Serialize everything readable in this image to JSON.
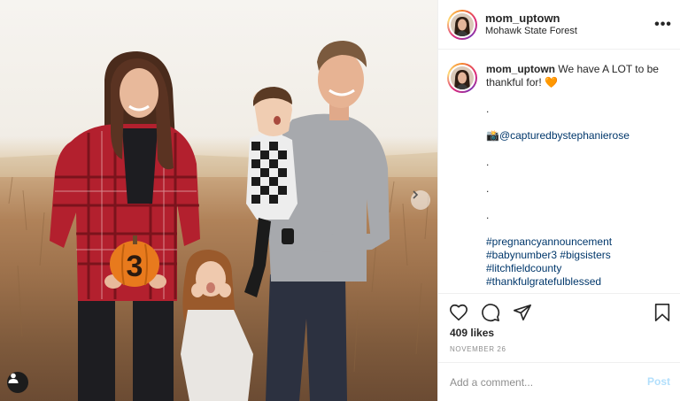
{
  "post": {
    "username": "mom_uptown",
    "location": "Mohawk State Forest",
    "more_label": "•••",
    "caption": {
      "username": "mom_uptown",
      "text": " We have A LOT to be thankful for! ",
      "heart_emoji": "🧡",
      "dot1": ".",
      "camera_emoji": "📸",
      "credit": "@capturedbystephanierose",
      "dot2": ".",
      "dot3": ".",
      "dot4": ".",
      "hashtags": [
        "#pregnancyannouncement",
        "#babynumber3 #bigsisters",
        "#litchfieldcounty",
        "#thankfulgratefulblessed"
      ]
    },
    "likes": "409 likes",
    "date": "NOVEMBER 26",
    "comment_placeholder": "Add a comment...",
    "post_label": "Post",
    "pumpkin_number": "3"
  },
  "colors": {
    "accent": "#0095f6",
    "post_disabled": "#b2dffc",
    "link": "#00376b",
    "muted": "#8e8e8e",
    "border": "#efefef"
  },
  "icons": {
    "more": "more-options-icon",
    "like": "heart-icon",
    "comment": "comment-icon",
    "share": "paper-plane-icon",
    "save": "bookmark-icon",
    "next": "chevron-right-icon",
    "user_tag": "user-tag-icon"
  }
}
